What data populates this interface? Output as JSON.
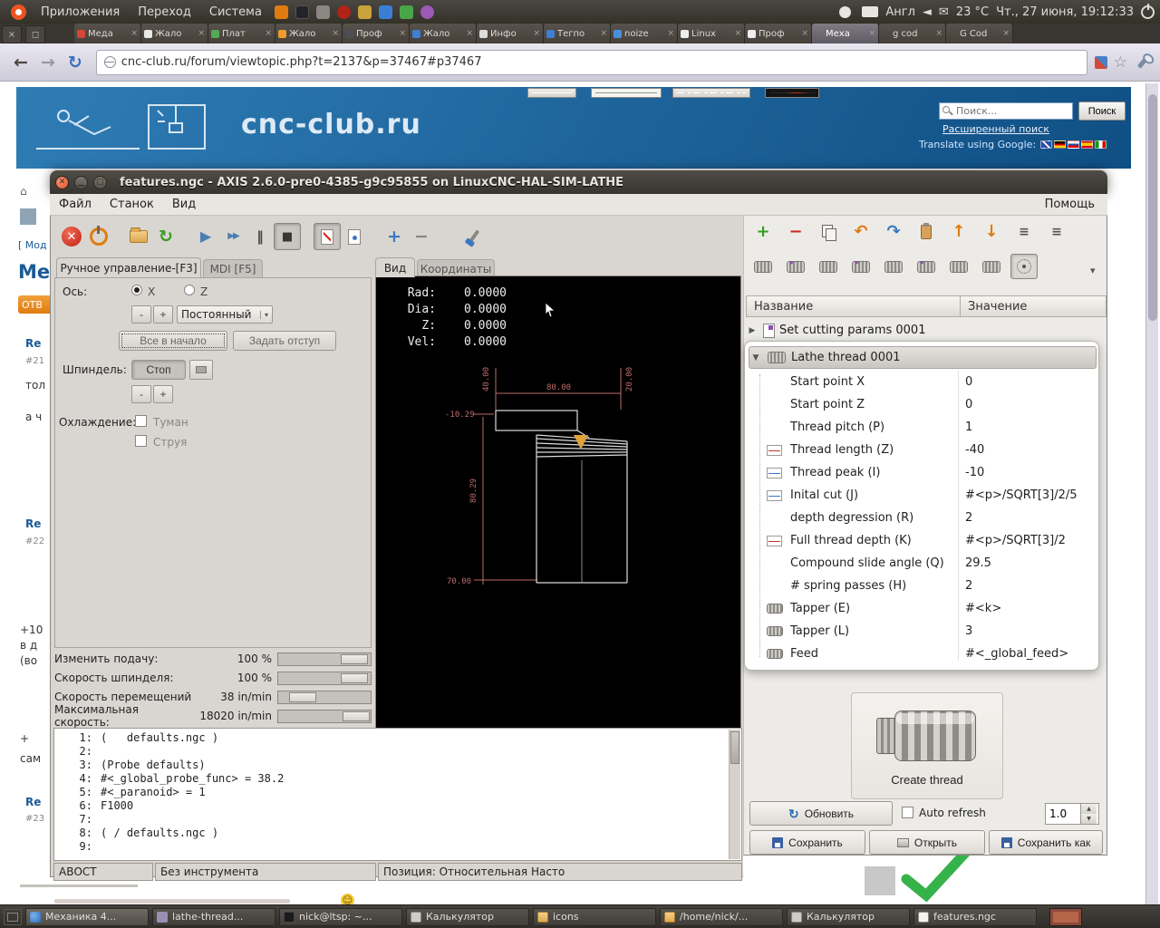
{
  "top_bar": {
    "menus": [
      "Приложения",
      "Переход",
      "Система"
    ],
    "keyboard_label": "Англ",
    "temperature": "23 °C",
    "clock": "Чт., 27 июня, 19:12:33"
  },
  "browser": {
    "tabs": [
      {
        "label": "Меда"
      },
      {
        "label": "Жало"
      },
      {
        "label": "Плат"
      },
      {
        "label": "Жало"
      },
      {
        "label": "Проф"
      },
      {
        "label": "Жало"
      },
      {
        "label": "Инфо"
      },
      {
        "label": "Тегпо"
      },
      {
        "label": "noize"
      },
      {
        "label": "Linux"
      },
      {
        "label": "Проф"
      },
      {
        "label": "Меха"
      },
      {
        "label": "g cod"
      },
      {
        "label": "G Cod"
      }
    ],
    "url": "cnc-club.ru/forum/viewtopic.php?t=2137&p=37467#p37467"
  },
  "site": {
    "logo": "cnc-club.ru",
    "search_placeholder": "Поиск...",
    "search_button": "Поиск",
    "advanced_search": "Расширенный поиск",
    "translate_label": "Translate using Google:"
  },
  "forum": {
    "breadcrumb": "[ Мод",
    "topic_heading": "Мех",
    "reply_button": "ОТВ",
    "fragments": [
      "Re",
      "#21",
      "тол",
      "а ч",
      "Re",
      "#22",
      "+10",
      "в д",
      "(во",
      "+",
      "сам",
      "Re",
      "#23"
    ]
  },
  "axis": {
    "title": "features.ngc - AXIS 2.6.0-pre0-4385-g9c95855 on LinuxCNC-HAL-SIM-LATHE",
    "menu": {
      "items": [
        "Файл",
        "Станок",
        "Вид"
      ],
      "help": "Помощь"
    },
    "tabs": {
      "manual": "Ручное управление-[F3]",
      "mdi": "MDI [F5]"
    },
    "manual": {
      "axis_label": "Ось:",
      "axis_x": "X",
      "axis_z": "Z",
      "jog_minus": "-",
      "jog_plus": "+",
      "jog_mode": "Постоянный",
      "home_all": "Все в начало",
      "touch_off": "Задать отступ",
      "spindle_label": "Шпиндель:",
      "spindle_stop": "Стоп",
      "spindle_minus": "-",
      "spindle_plus": "+",
      "coolant_label": "Охлаждение:",
      "mist": "Туман",
      "flood": "Струя"
    },
    "overrides": [
      {
        "label": "Изменить подачу:",
        "value": "100 %"
      },
      {
        "label": "Скорость шпинделя:",
        "value": "100 %"
      },
      {
        "label": "Скорость перемещений",
        "value": "38 in/min"
      },
      {
        "label": "Максимальная скорость:",
        "value": "18020 in/min"
      }
    ],
    "preview": {
      "view_tab": "Вид",
      "coords_tab": "Координаты",
      "dro": [
        {
          "label": "Rad:",
          "value": "0.0000"
        },
        {
          "label": "Dia:",
          "value": "0.0000"
        },
        {
          "label": "Z:",
          "value": "0.0000"
        },
        {
          "label": "Vel:",
          "value": "0.0000"
        }
      ],
      "dims": {
        "d40": "40.00",
        "d80": "80.00",
        "d20": "20.00",
        "dm1029": "-10.29",
        "d8029": "80.29",
        "d70": "70.00"
      }
    },
    "gcode": [
      {
        "num": "1:",
        "text": "(   defaults.ngc )"
      },
      {
        "num": "2:",
        "text": ""
      },
      {
        "num": "3:",
        "text": "(Probe defaults)"
      },
      {
        "num": "4:",
        "text": "#<_global_probe_func> = 38.2"
      },
      {
        "num": "5:",
        "text": "#<_paranoid> = 1"
      },
      {
        "num": "6:",
        "text": "F1000"
      },
      {
        "num": "7:",
        "text": ""
      },
      {
        "num": "8:",
        "text": "( / defaults.ngc )"
      },
      {
        "num": "9:",
        "text": ""
      }
    ],
    "status": {
      "estop": "АВОСТ",
      "tool": "Без инструмента",
      "position": "Позиция: Относительная Насто"
    }
  },
  "features": {
    "columns": {
      "name": "Название",
      "value": "Значение"
    },
    "root_row": {
      "label": "Set cutting params 0001"
    },
    "selected_feature": {
      "label": "Lathe thread 0001"
    },
    "params": [
      {
        "label": "Start point X",
        "value": "0"
      },
      {
        "label": "Start point Z",
        "value": "0"
      },
      {
        "label": "Thread pitch (P)",
        "value": "1"
      },
      {
        "label": "Thread length (Z)",
        "value": "-40"
      },
      {
        "label": "Thread peak (I)",
        "value": "-10"
      },
      {
        "label": "Inital cut (J)",
        "value": "#<p>/SQRT[3]/2/5"
      },
      {
        "label": "depth degression (R)",
        "value": "2"
      },
      {
        "label": "Full thread depth (K)",
        "value": "#<p>/SQRT[3]/2"
      },
      {
        "label": "Compound slide angle (Q)",
        "value": "29.5"
      },
      {
        "label": "# spring passes (H)",
        "value": "2"
      },
      {
        "label": "Tapper (E)",
        "value": "#<k>"
      },
      {
        "label": "Tapper (L)",
        "value": "3"
      },
      {
        "label": "Feed",
        "value": "#<_global_feed>"
      }
    ],
    "create_button": "Create thread",
    "refresh_button": "Обновить",
    "auto_refresh_label": "Auto refresh",
    "refresh_interval": "1.0",
    "save_button": "Сохранить",
    "open_button": "Открыть",
    "save_as_button": "Сохранить как"
  },
  "taskbar": {
    "items": [
      {
        "label": "Механика 4..."
      },
      {
        "label": "lathe-thread..."
      },
      {
        "label": "nick@ltsp: ~..."
      },
      {
        "label": "Калькулятор"
      },
      {
        "label": "icons"
      },
      {
        "label": "/home/nick/..."
      },
      {
        "label": "Калькулятор"
      },
      {
        "label": "features.ngc"
      }
    ]
  },
  "icons": {
    "close": "×",
    "dropdown": "▾",
    "collapsed": "▶",
    "expanded": "▼",
    "plus": "+",
    "minus": "−",
    "undo": "↶",
    "redo": "↷",
    "up": "↑",
    "down": "↓",
    "back": "←",
    "forward": "→",
    "reload": "↻",
    "star": "☆",
    "play": "▶",
    "ffwd": "▶▶",
    "pause": "‖",
    "stop": "■",
    "cross": "✕",
    "mail": "✉",
    "home": "⌂",
    "smiley": "☺",
    "list": "≡",
    "volume": "◄"
  }
}
